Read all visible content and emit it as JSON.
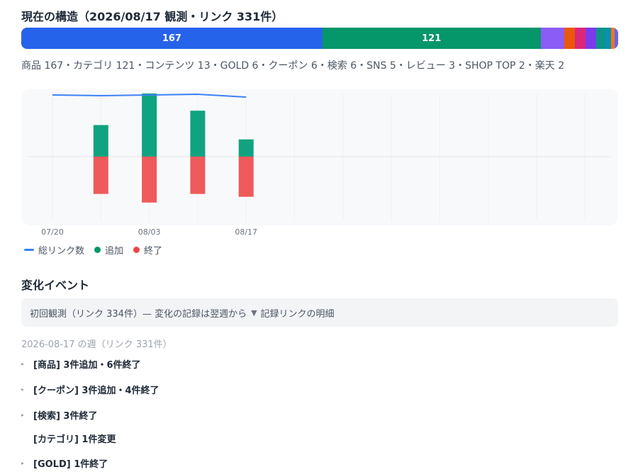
{
  "structure": {
    "title": "現在の構造（2026/08/17 観測・リンク 331件）",
    "segments": [
      {
        "label": "167",
        "value": 167,
        "color": "#2563eb"
      },
      {
        "label": "121",
        "value": 121,
        "color": "#059669"
      },
      {
        "label": "",
        "value": 13,
        "color": "#8b5cf6"
      },
      {
        "label": "",
        "value": 6,
        "color": "#ea580c"
      },
      {
        "label": "",
        "value": 6,
        "color": "#db2777"
      },
      {
        "label": "",
        "value": 6,
        "color": "#7c3aed"
      },
      {
        "label": "",
        "value": 5,
        "color": "#0d9488"
      },
      {
        "label": "",
        "value": 3,
        "color": "#0891b2"
      },
      {
        "label": "",
        "value": 2,
        "color": "#f97316"
      },
      {
        "label": "",
        "value": 2,
        "color": "#6366f1"
      }
    ],
    "summary": "商品 167・カテゴリ 121・コンテンツ 13・GOLD 6・クーポン 6・検索 6・SNS 5・レビュー 3・SHOP TOP 2・楽天 2"
  },
  "chart_data": {
    "type": "bar",
    "x": [
      "07/20",
      "07/27",
      "08/03",
      "08/10",
      "08/17"
    ],
    "x_tick_labels": [
      "07/20",
      "08/03",
      "08/17"
    ],
    "series": [
      {
        "name": "総リンク数",
        "type": "line",
        "color": "#3b82f6",
        "values": [
          334,
          333,
          334,
          335,
          331
        ]
      },
      {
        "name": "追加",
        "type": "bar",
        "color": "#10a37f",
        "values": [
          0,
          11,
          22,
          16,
          6
        ]
      },
      {
        "name": "終了",
        "type": "bar",
        "color": "#ef5a5a",
        "values": [
          0,
          -13,
          -16,
          -13,
          -14
        ]
      }
    ],
    "grid": true,
    "legend": "bottom-left"
  },
  "legend": {
    "total": "総リンク数",
    "added": "追加",
    "ended": "終了",
    "total_color": "#3b82f6",
    "added_color": "#059669",
    "ended_color": "#ef4444"
  },
  "events": {
    "title": "変化イベント",
    "first_obs": "初回観測（リンク 334件）— 変化の記録は翌週から",
    "details_toggle": "記録リンクの明細",
    "week_label": "2026-08-17 の週（リンク 331件）",
    "items": [
      {
        "text": "[商品] 3件追加・6件終了",
        "expandable": true
      },
      {
        "text": "[クーポン] 3件追加・4件終了",
        "expandable": true
      },
      {
        "text": "[検索] 3件終了",
        "expandable": true
      },
      {
        "text": "[カテゴリ] 1件変更",
        "expandable": false
      },
      {
        "text": "[GOLD] 1件終了",
        "expandable": true
      }
    ]
  }
}
